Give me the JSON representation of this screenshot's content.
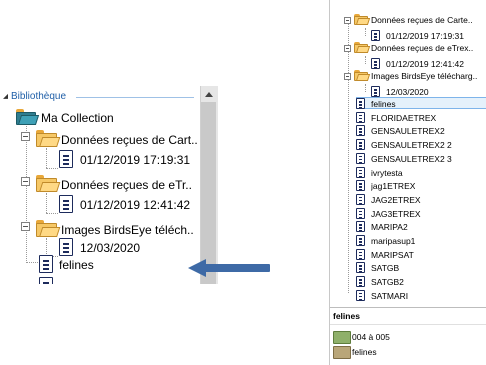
{
  "left_panel": {
    "section_label": "Bibliothèque",
    "root": "Ma Collection",
    "items": [
      {
        "label": "Données reçues de Cart..",
        "child": "01/12/2019 17:19:31"
      },
      {
        "label": "Données reçues de eTr..",
        "child": "01/12/2019 12:41:42"
      },
      {
        "label": "Images BirdsEye téléch..",
        "child": "12/03/2020"
      }
    ],
    "last_item": "felines"
  },
  "right_panel": {
    "folders": [
      {
        "label": "Données reçues de Carte..",
        "child": "01/12/2019 17:19:31"
      },
      {
        "label": "Données reçues de eTrex..",
        "child": "01/12/2019 12:41:42"
      },
      {
        "label": "Images BirdsEye télécharg..",
        "child": "12/03/2020"
      }
    ],
    "files": [
      "felines",
      "FLORIDAETREX",
      "GENSAULETREX2",
      "GENSAULETREX2 2",
      "GENSAULETREX2 3",
      "ivrytesta",
      "jag1ETREX",
      "JAG2ETREX",
      "JAG3ETREX",
      "MARIPA2",
      "maripasup1",
      "MARIPSAT",
      "SATGB",
      "SATGB2",
      "SATMARI"
    ],
    "selected_index": 0,
    "status_title": "felines",
    "status_rows": [
      "004 à 005",
      "felines"
    ]
  },
  "colors": {
    "arrow": "#3e6aa6",
    "folder": "#f6c867",
    "selection": "#e5f1fb",
    "link": "#1f5fa8"
  },
  "icons": {
    "folder": "folder-icon",
    "document": "document-icon",
    "collapse": "collapse-icon",
    "tracks": "tracks-icon",
    "map": "map-icon"
  }
}
